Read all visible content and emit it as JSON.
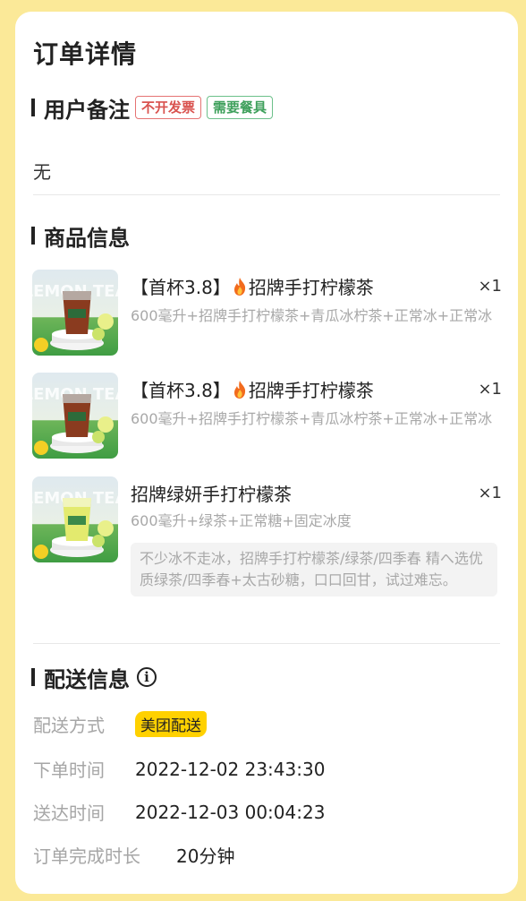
{
  "page": {
    "title": "订单详情"
  },
  "remark": {
    "section_title": "用户备注",
    "tags": [
      "不开发票",
      "需要餐具"
    ],
    "text": "无"
  },
  "products": {
    "section_title": "商品信息",
    "items": [
      {
        "name_prefix": "【首杯3.8】",
        "flame_icon": "fire-emoji",
        "name_suffix": "招牌手打柠檬茶",
        "qty": "×1",
        "spec": "600毫升+招牌手打柠檬茶+青瓜冰柠茶+正常冰+正常冰",
        "image_label": "LEMON TEA"
      },
      {
        "name_prefix": "【首杯3.8】",
        "flame_icon": "fire-emoji",
        "name_suffix": "招牌手打柠檬茶",
        "qty": "×1",
        "spec": "600毫升+招牌手打柠檬茶+青瓜冰柠茶+正常冰+正常冰",
        "image_label": "LEMON TEA"
      },
      {
        "name": "招牌绿妍手打柠檬茶",
        "qty": "×1",
        "spec": "600毫升+绿茶+正常糖+固定冰度",
        "note": "不少冰不走冰，招牌手打柠檬茶/绿茶/四季春 精へ选优质绿茶/四季春+太古砂糖，口口回甘，试过难忘。",
        "image_label": "LEMON TEA"
      }
    ]
  },
  "delivery": {
    "section_title": "配送信息",
    "info_icon": "info-circle-icon",
    "method_label": "配送方式",
    "method_value": "美团配送",
    "order_time_label": "下单时间",
    "order_time_value": "2022-12-02 23:43:30",
    "arrive_time_label": "送达时间",
    "arrive_time_value": "2022-12-03 00:04:23",
    "duration_label": "订单完成时长",
    "duration_value": "20分钟"
  },
  "colors": {
    "background": "#fbe998",
    "card": "#ffffff",
    "tag_red": "#d9534f",
    "tag_green": "#3fa05c",
    "delivery_badge": "#ffd100"
  }
}
